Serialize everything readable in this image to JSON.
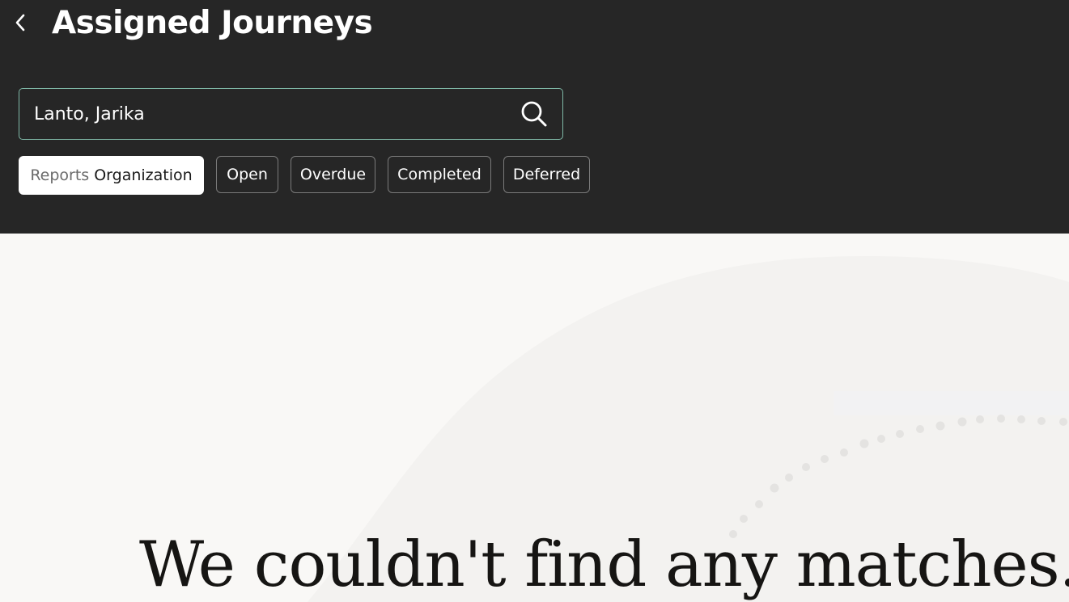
{
  "header": {
    "title": "Assigned Journeys",
    "back_icon": "chevron-left-icon"
  },
  "search": {
    "value": "Lanto, Jarika",
    "icon": "search-icon"
  },
  "filters": [
    {
      "key": "Reports",
      "value": "Organization",
      "selected": true
    },
    {
      "label": "Open",
      "selected": false
    },
    {
      "label": "Overdue",
      "selected": false
    },
    {
      "label": "Completed",
      "selected": false
    },
    {
      "label": "Deferred",
      "selected": false
    }
  ],
  "empty_state": {
    "title": "We couldn't find any matches."
  },
  "colors": {
    "header_bg": "#262626",
    "content_bg": "#f9f8f6",
    "search_border": "#7fb8a7"
  }
}
